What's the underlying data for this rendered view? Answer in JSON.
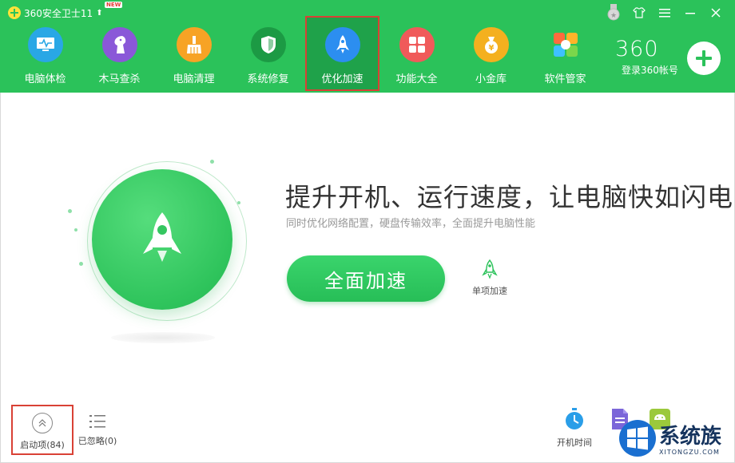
{
  "window": {
    "app_title": "360安全卫士11",
    "new_badge": "NEW"
  },
  "nav": {
    "items": [
      {
        "label": "电脑体检",
        "icon": "monitor-icon",
        "color": "#29a7e5"
      },
      {
        "label": "木马查杀",
        "icon": "horse-icon",
        "color": "#8a58d8"
      },
      {
        "label": "电脑清理",
        "icon": "broom-icon",
        "color": "#f7a325"
      },
      {
        "label": "系统修复",
        "icon": "shield-icon",
        "color": "#1c9a44"
      },
      {
        "label": "优化加速",
        "icon": "rocket-icon",
        "color": "#2c8ef0",
        "active": true
      },
      {
        "label": "功能大全",
        "icon": "grid-icon",
        "color": "#f05a5a"
      },
      {
        "label": "小金库",
        "icon": "money-bag-icon",
        "color": "#f4b01f"
      },
      {
        "label": "软件管家",
        "icon": "apps-icon",
        "color": "#ff8a34"
      }
    ]
  },
  "login": {
    "logo": "360",
    "label": "登录360帐号"
  },
  "main": {
    "headline": "提升开机、运行速度，让电脑快如闪电",
    "subline": "同时优化网络配置，硬盘传输效率，全面提升电脑性能",
    "speed_button": "全面加速",
    "single_speed": "单项加速"
  },
  "bottom_left": {
    "startup_label": "启动项(84)",
    "ignored_label": "已忽略(0)"
  },
  "bottom_right": {
    "boot_time_label": "开机时间"
  },
  "watermark": {
    "text": "系统族",
    "sub": "XITONGZU.COM"
  },
  "colors": {
    "header_green": "#2bc25a",
    "active_tab": "#1fa24a",
    "highlight_red": "#d94135",
    "button_green": "#2fc45c"
  }
}
